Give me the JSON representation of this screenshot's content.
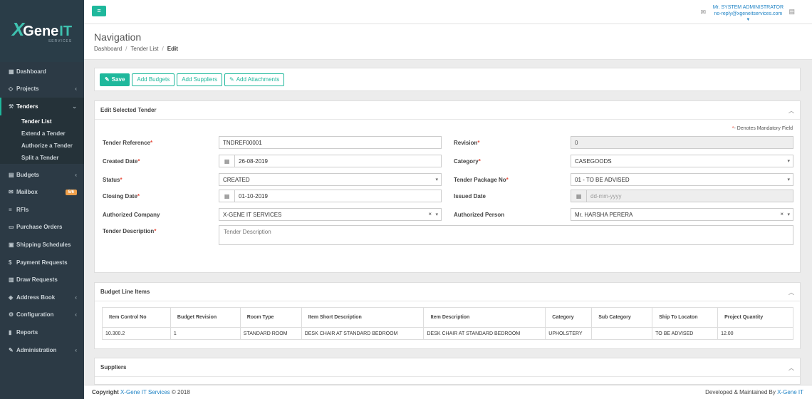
{
  "brand": {
    "x": "X",
    "gene": "Gene",
    "it": "IT",
    "sub": "SERVICES"
  },
  "topbar": {
    "user_name": "Mr. SYSTEM ADMINISTRATOR",
    "user_email": "no-reply@xgeneitservices.com"
  },
  "sidebar": {
    "items": [
      {
        "label": "Dashboard"
      },
      {
        "label": "Projects"
      },
      {
        "label": "Tenders"
      },
      {
        "label": "Budgets"
      },
      {
        "label": "Mailbox",
        "badge": "5/6"
      },
      {
        "label": "RFIs"
      },
      {
        "label": "Purchase Orders"
      },
      {
        "label": "Shipping Schedules"
      },
      {
        "label": "Payment Requests"
      },
      {
        "label": "Draw Requests"
      },
      {
        "label": "Address Book"
      },
      {
        "label": "Configuration"
      },
      {
        "label": "Reports"
      },
      {
        "label": "Administration"
      }
    ],
    "tender_sub": [
      "Tender List",
      "Extend a Tender",
      "Authorize a Tender",
      "Split a Tender"
    ]
  },
  "page": {
    "title": "Navigation",
    "breadcrumb": [
      "Dashboard",
      "Tender List",
      "Edit"
    ]
  },
  "toolbar": {
    "save": "Save",
    "add_budgets": "Add Budgets",
    "add_suppliers": "Add Suppliers",
    "add_attachments": "Add Attachments"
  },
  "form": {
    "title": "Edit Selected Tender",
    "mandatory_note": "- Denotes Mandatory Field",
    "tender_reference": {
      "label": "Tender Reference",
      "value": "TNDREF00001"
    },
    "revision": {
      "label": "Revision",
      "value": "0"
    },
    "created_date": {
      "label": "Created Date",
      "value": "26-08-2019"
    },
    "category": {
      "label": "Category",
      "value": "CASEGOODS"
    },
    "status": {
      "label": "Status",
      "value": "CREATED"
    },
    "tender_package": {
      "label": "Tender Package No",
      "value": "01 - TO BE ADVISED"
    },
    "closing_date": {
      "label": "Closing Date",
      "value": "01-10-2019"
    },
    "issued_date": {
      "label": "Issued Date",
      "placeholder": "dd-mm-yyyy"
    },
    "authorized_company": {
      "label": "Authorized Company",
      "value": "X-GENE IT SERVICES"
    },
    "authorized_person": {
      "label": "Authorized Person",
      "value": "Mr. HARSHA PERERA"
    },
    "description": {
      "label": "Tender Description",
      "placeholder": "Tender Description"
    }
  },
  "budget": {
    "title": "Budget Line Items",
    "columns": [
      "Item Control No",
      "Budget Revision",
      "Room Type",
      "Item Short Description",
      "Item Description",
      "Category",
      "Sub Category",
      "Ship To Locaton",
      "Project Quantity"
    ],
    "rows": [
      [
        "10.300.2",
        "1",
        "STANDARD ROOM",
        "DESK CHAIR AT STANDARD BEDROOM",
        "DESK CHAIR AT STANDARD BEDROOM",
        "UPHOLSTERY",
        "",
        "TO BE ADVISED",
        "12.00"
      ]
    ]
  },
  "suppliers": {
    "title": "Suppliers"
  },
  "footer": {
    "copyright": "Copyright",
    "company": "X-Gene IT Services",
    "year": "© 2018",
    "developed": "Developed & Maintained By",
    "dev_company": "X-Gene IT"
  }
}
